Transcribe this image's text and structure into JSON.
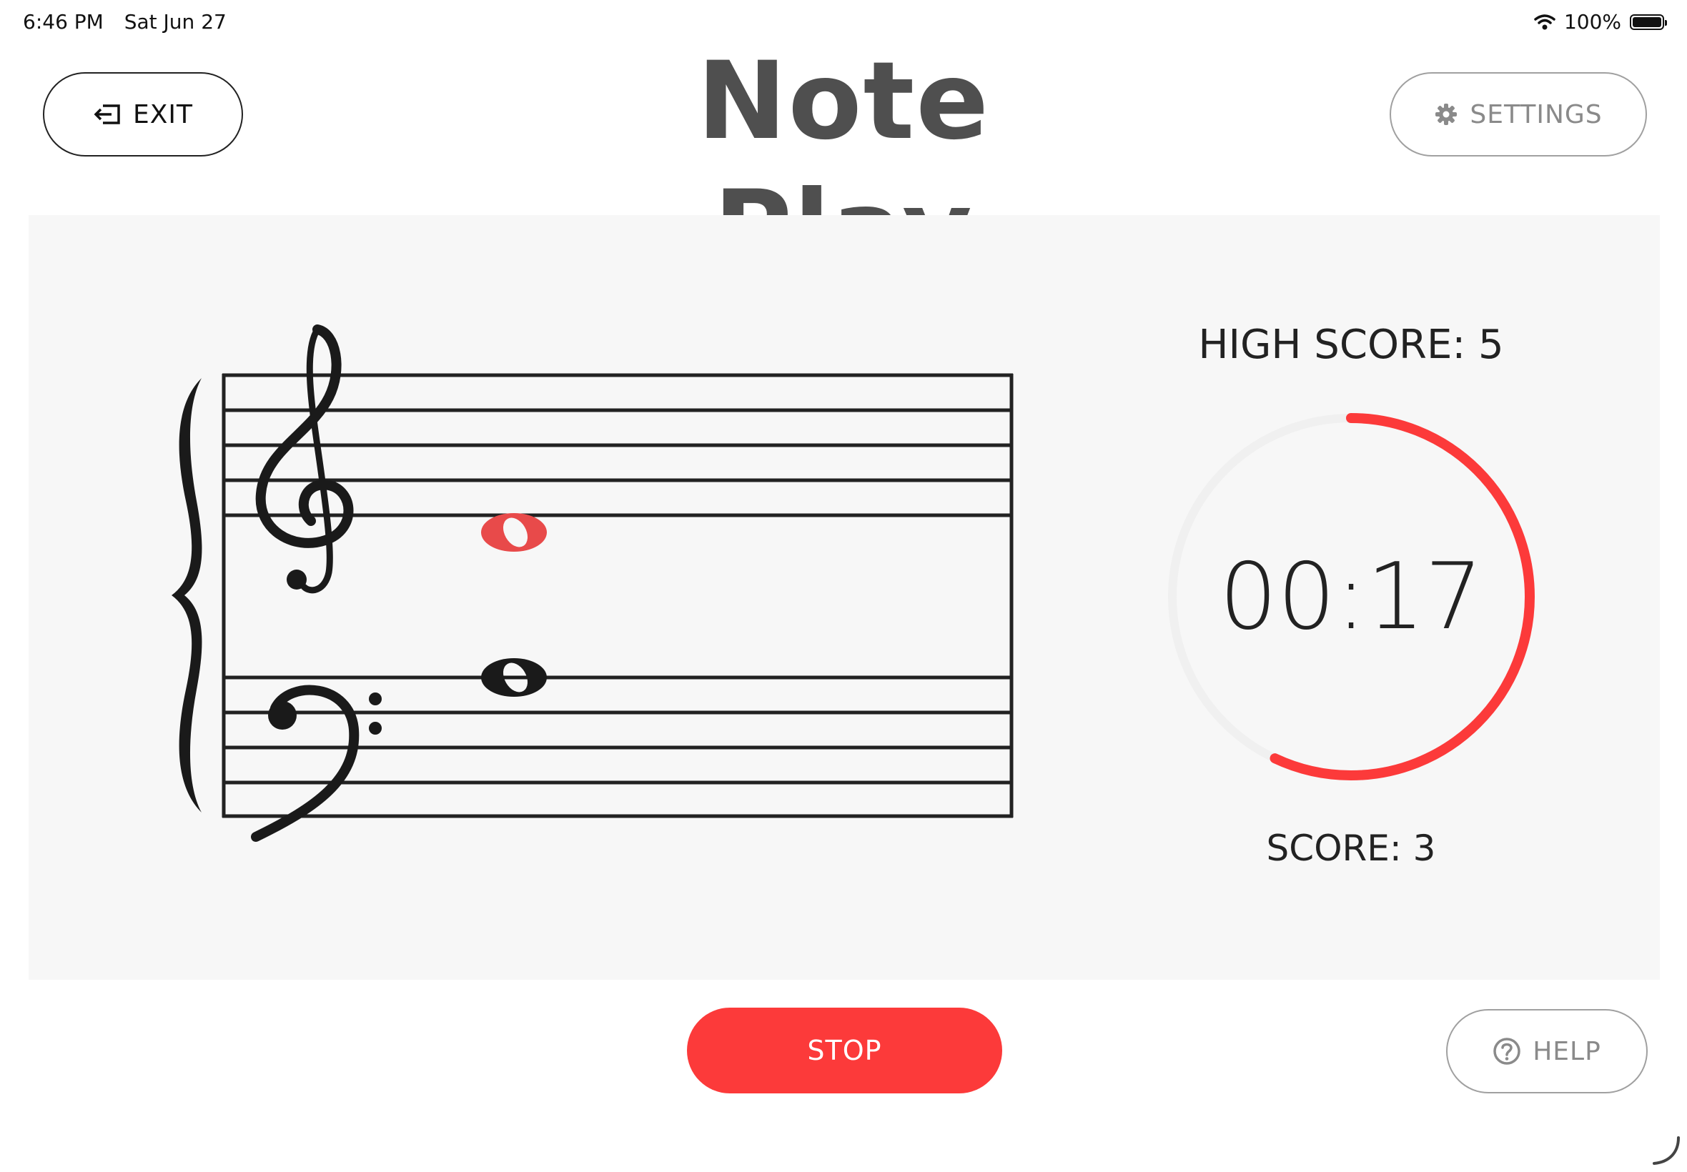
{
  "status_bar": {
    "time": "6:46 PM",
    "date": "Sat Jun 27",
    "battery": "100%"
  },
  "header": {
    "title": "Note Play",
    "exit_label": "EXIT",
    "settings_label": "SETTINGS"
  },
  "game": {
    "high_score": "HIGH SCORE: 5",
    "timer": "00:17",
    "timer_remaining_fraction": 0.57,
    "score": "SCORE: 3",
    "target_note_color": "#e84a4a",
    "accent_color": "#fc3a3a"
  },
  "footer": {
    "stop_label": "STOP",
    "help_label": "HELP"
  }
}
